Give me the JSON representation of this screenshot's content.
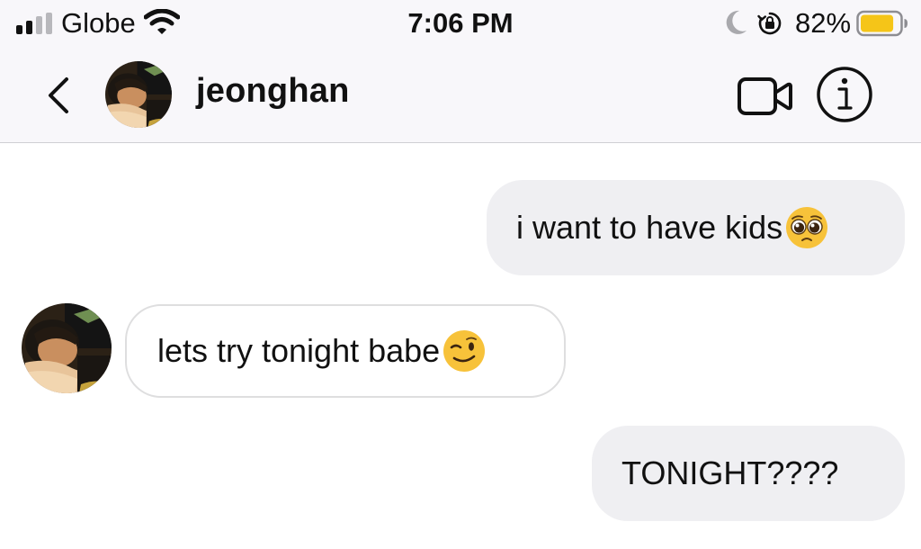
{
  "status_bar": {
    "carrier": "Globe",
    "time": "7:06 PM",
    "battery_percent": "82%",
    "battery_level": 0.82,
    "signal_bars_active": 2,
    "signal_bars_total": 4
  },
  "header": {
    "username": "jeonghan"
  },
  "messages": [
    {
      "direction": "outgoing",
      "text": "i want to have kids",
      "emoji": "pleading-face"
    },
    {
      "direction": "incoming",
      "text": "lets try tonight babe",
      "emoji": "winking-face"
    },
    {
      "direction": "outgoing",
      "text": "TONIGHT????"
    }
  ],
  "colors": {
    "header_bg": "#f8f7fa",
    "outgoing_bubble": "#efeff2",
    "incoming_border": "#dededf",
    "battery_fill": "#f5c518",
    "emoji_yellow": "#f7c23a"
  }
}
